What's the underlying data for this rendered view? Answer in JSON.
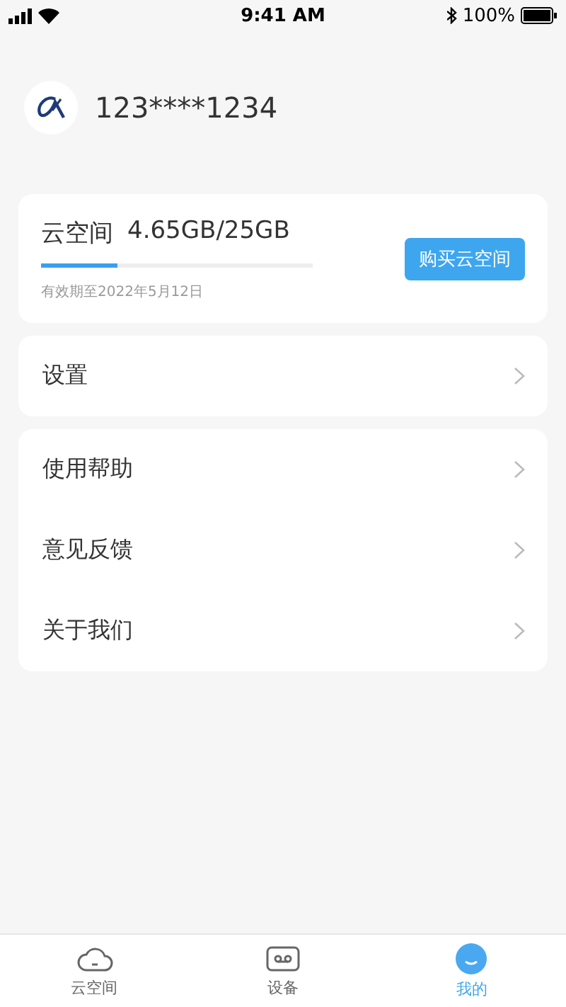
{
  "status_bar": {
    "time": "9:41 AM",
    "battery": "100%"
  },
  "profile": {
    "account": "123****1234"
  },
  "storage": {
    "label": "云空间",
    "usage": "4.65GB/25GB",
    "level": 0.28,
    "expiry": "有效期至2022年5月12日",
    "button": "购买云空间"
  },
  "menu_groups": [
    [
      {
        "label": "设置"
      }
    ],
    [
      {
        "label": "使用帮助"
      },
      {
        "label": "意见反馈"
      },
      {
        "label": "关于我们"
      }
    ]
  ],
  "tabs": [
    {
      "kind": "cloud",
      "label": "云空间",
      "selected": false
    },
    {
      "kind": "device",
      "label": "设备",
      "selected": false
    },
    {
      "kind": "me",
      "label": "我的",
      "selected": true
    }
  ]
}
